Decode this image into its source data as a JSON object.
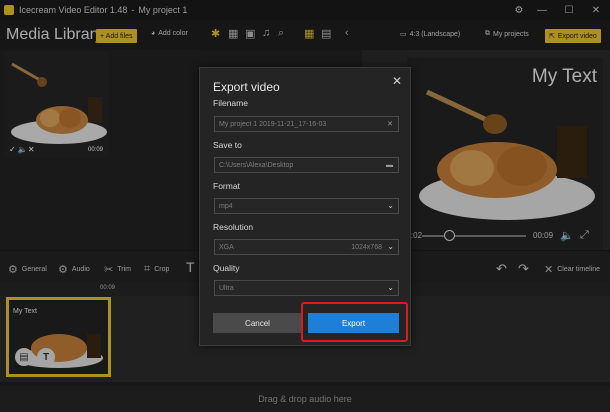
{
  "window": {
    "app_name": "Icecream Video Editor 1.48",
    "separator": "-",
    "project_name": "My project 1",
    "gear_glyph": "⚙",
    "minimize_glyph": "—",
    "maximize_glyph": "☐",
    "close_glyph": "✕"
  },
  "toolbar": {
    "title": "Media Library",
    "add_files": "+ Add files",
    "add_color": "Add color",
    "aspect": "4:3 (Landscape)",
    "my_projects": "My projects",
    "export_video": "Export video"
  },
  "media": {
    "thumb_duration": "00:09",
    "thumb_check": "✓ 🔈✕"
  },
  "preview": {
    "overlay_text": "My Text",
    "time_left": "00:02",
    "time_right": "00:09"
  },
  "edit_tools": {
    "general": "General",
    "audio": "Audio",
    "trim": "Trim",
    "crop": "Crop",
    "clear": "Clear timeline"
  },
  "timeline": {
    "ruler_time": "00:09",
    "clip_text": "My Text",
    "drop_hint": "Drag & drop audio here"
  },
  "dialog": {
    "title": "Export video",
    "close": "✕",
    "filename_label": "Filename",
    "filename_value": "My project 1 2019-11-21_17-16-03",
    "filename_clear": "✕",
    "saveto_label": "Save to",
    "saveto_value": "C:\\Users\\Alexa\\Desktop",
    "format_label": "Format",
    "format_value": "mp4",
    "resolution_label": "Resolution",
    "resolution_value": "XGA",
    "resolution_size": "1024x768",
    "quality_label": "Quality",
    "quality_value": "Ultra",
    "cancel": "Cancel",
    "export": "Export"
  },
  "colors": {
    "accent": "#e9c12b",
    "export_button": "#1e7fd8",
    "highlight": "#e0191f"
  },
  "icons": [
    "gear-icon",
    "minimize-icon",
    "maximize-icon",
    "close-icon",
    "palette-icon",
    "star-icon",
    "film-icon",
    "image-icon",
    "music-icon",
    "search-icon",
    "grid-icon",
    "list-icon",
    "chevron-left-icon",
    "monitor-icon",
    "projects-icon",
    "export-icon",
    "volume-icon",
    "fullscreen-icon",
    "general-icon",
    "audio-icon",
    "trim-icon",
    "crop-icon",
    "text-icon",
    "undo-icon",
    "redo-icon",
    "clear-icon",
    "folder-icon",
    "chevron-down-icon"
  ]
}
